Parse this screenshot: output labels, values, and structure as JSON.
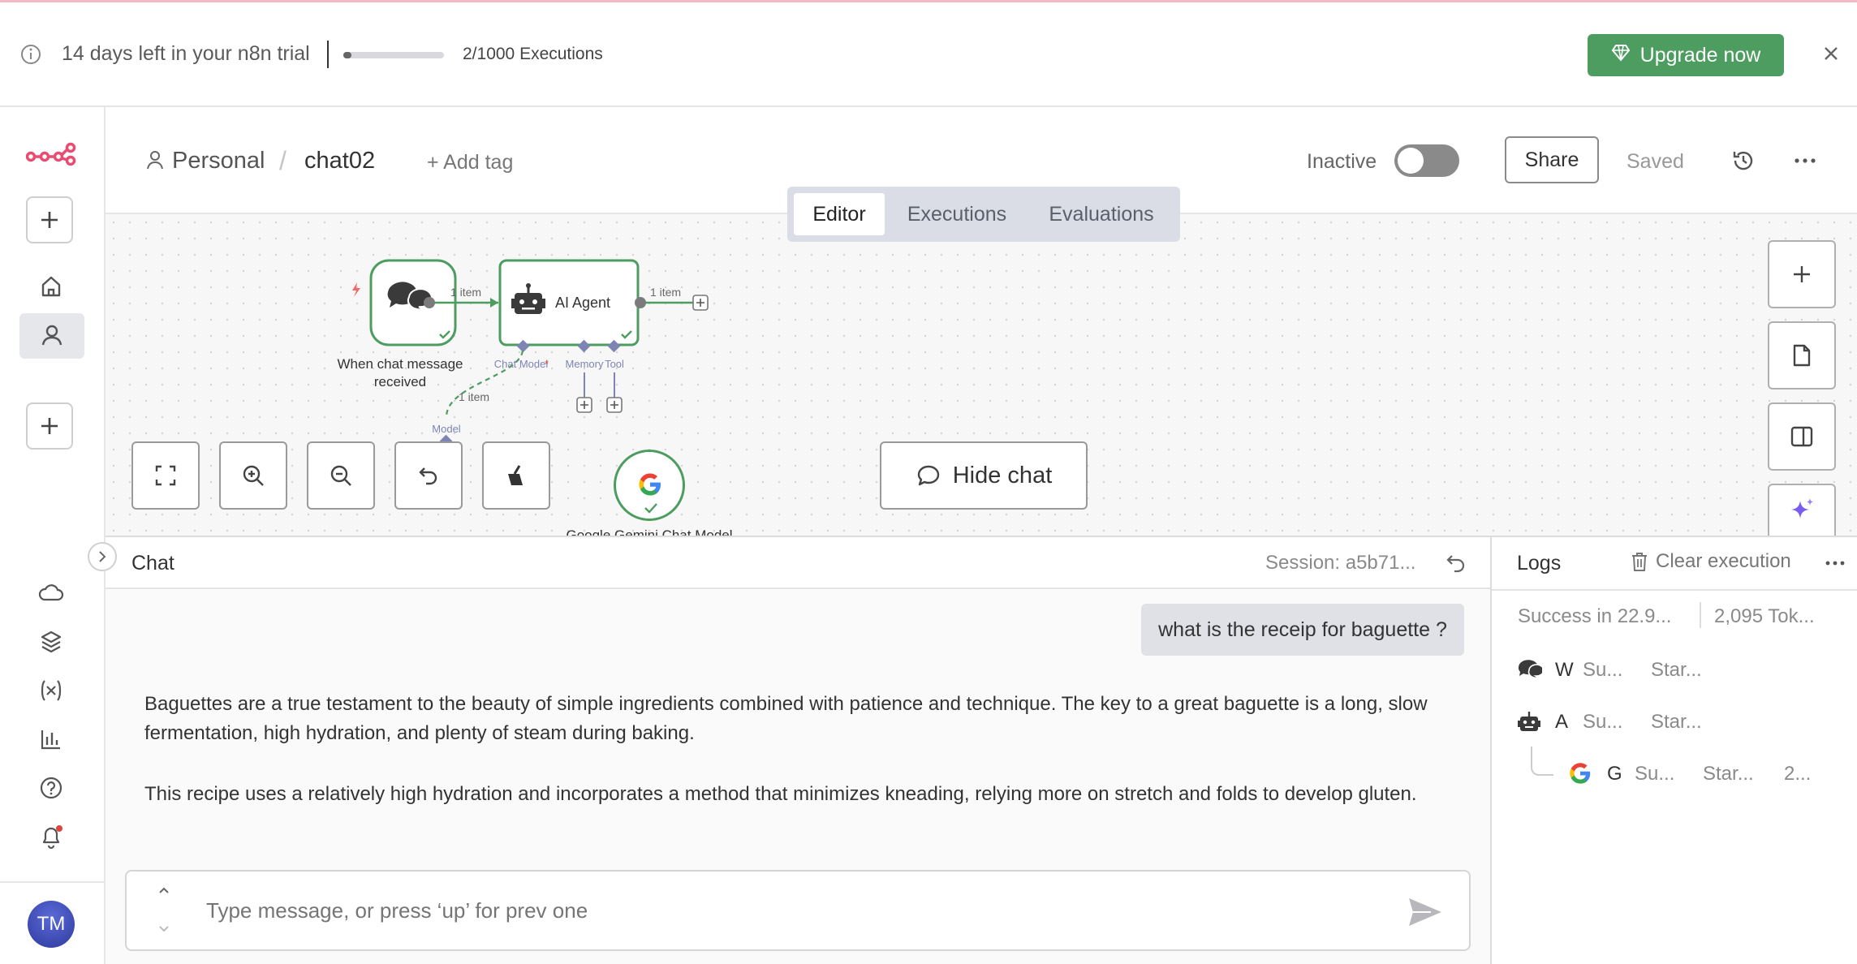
{
  "banner": {
    "trial_text": "14 days left in your n8n trial",
    "executions_text": "2/1000 Executions",
    "executions_used_fraction": 0.002,
    "upgrade_label": "Upgrade now",
    "upgrade_color": "#4c9d5f"
  },
  "header": {
    "project": "Personal",
    "separator": "/",
    "workflow_name": "chat02",
    "add_tag_label": "+ Add tag",
    "status_label": "Inactive",
    "share_label": "Share",
    "saved_label": "Saved"
  },
  "tabs": [
    "Editor",
    "Executions",
    "Evaluations"
  ],
  "canvas": {
    "trigger_node_label_line1": "When chat message",
    "trigger_node_label_line2": "received",
    "agent_node_label": "AI Agent",
    "agent_ports": [
      "Chat Model",
      "Memory",
      "Tool"
    ],
    "required_marker": "*",
    "edge_item_labels": [
      "1 item",
      "1 item",
      "1 item"
    ],
    "model_port_label": "Model",
    "gemini_node_label": "Google Gemini Chat Model",
    "hide_chat_label": "Hide chat",
    "accent_green": "#4c9d5f",
    "port_color": "#7e84b4"
  },
  "chat": {
    "title": "Chat",
    "session_label": "Session: a5b71...",
    "user_message": "what is the receip for baguette ?",
    "bot_paragraphs": [
      "Baguettes are a true testament to the beauty of simple ingredients combined with patience and technique. The key to a great baguette is a long, slow fermentation, high hydration, and plenty of steam during baking.",
      "This recipe uses a relatively high hydration and incorporates a method that minimizes kneading, relying more on stretch and folds to develop gluten."
    ],
    "input_placeholder": "Type message, or press ‘up’ for prev one"
  },
  "logs": {
    "title": "Logs",
    "clear_label": "Clear execution",
    "summary_status": "Success in 22.9...",
    "summary_tokens": "2,095 Tok...",
    "rows": [
      {
        "icon": "chat-bubbles-icon",
        "name": "W",
        "status": "Su...",
        "started": "Star...",
        "extra": ""
      },
      {
        "icon": "robot-icon",
        "name": "A",
        "status": "Su...",
        "started": "Star...",
        "extra": ""
      },
      {
        "icon": "google-icon",
        "name": "G",
        "status": "Su...",
        "started": "Star...",
        "extra": "2..."
      }
    ]
  },
  "user": {
    "initials": "TM"
  }
}
